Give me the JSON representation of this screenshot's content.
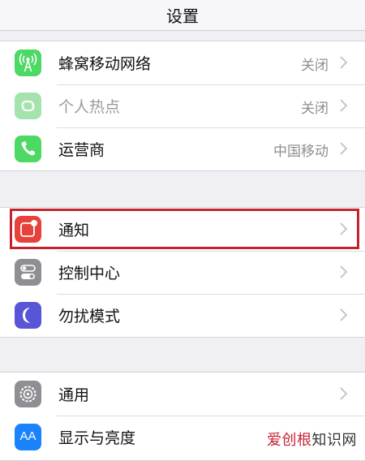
{
  "nav": {
    "title": "设置"
  },
  "groups": [
    {
      "items": [
        {
          "label": "蜂窝移动网络",
          "value": "关闭",
          "icon": "cellular-antenna-icon",
          "color": "#4cd964"
        },
        {
          "label": "个人热点",
          "value": "关闭",
          "icon": "hotspot-link-icon",
          "color": "#a4e3ae",
          "disabled": true
        },
        {
          "label": "运营商",
          "value": "中国移动",
          "icon": "phone-icon",
          "color": "#4cd964"
        }
      ]
    },
    {
      "items": [
        {
          "label": "通知",
          "value": "",
          "icon": "notifications-icon",
          "color": "#e8413b"
        },
        {
          "label": "控制中心",
          "value": "",
          "icon": "control-center-toggles-icon",
          "color": "#8e8e93"
        },
        {
          "label": "勿扰模式",
          "value": "",
          "icon": "moon-icon",
          "color": "#5856d6"
        }
      ]
    },
    {
      "items": [
        {
          "label": "通用",
          "value": "",
          "icon": "gear-icon",
          "color": "#8e8e93"
        },
        {
          "label": "显示与亮度",
          "value": "",
          "icon": "text-size-aa-icon",
          "color": "#1a82fb",
          "icon_text": "AA"
        }
      ]
    }
  ],
  "watermark": {
    "part1": "爱创根",
    "part2": "知识网"
  },
  "colors": {
    "highlight": "#c3232f"
  }
}
